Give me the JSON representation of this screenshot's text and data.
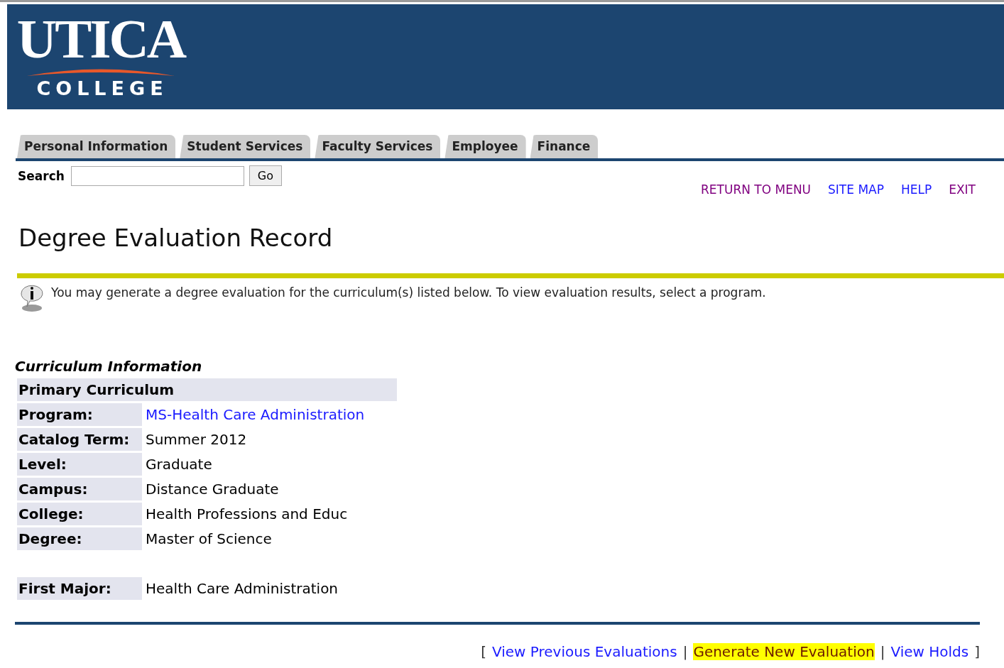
{
  "header": {
    "logo_word": "UTICA",
    "logo_subword": "COLLEGE"
  },
  "tabs": [
    {
      "label": "Personal Information"
    },
    {
      "label": "Student Services"
    },
    {
      "label": "Faculty Services"
    },
    {
      "label": "Employee"
    },
    {
      "label": "Finance"
    }
  ],
  "search": {
    "label": "Search",
    "button": "Go"
  },
  "nav_links": [
    {
      "label": "RETURN TO MENU",
      "visited": true
    },
    {
      "label": "SITE MAP",
      "visited": false
    },
    {
      "label": "HELP",
      "visited": false
    },
    {
      "label": "EXIT",
      "visited": true
    }
  ],
  "title": "Degree Evaluation Record",
  "info_message": "You may generate a degree evaluation for the curriculum(s) listed below. To view evaluation results, select a program.",
  "curriculum": {
    "heading": "Curriculum Information",
    "section": "Primary Curriculum",
    "rows": [
      {
        "label": "Program:",
        "value": "MS-Health Care Administration",
        "kind": "link"
      },
      {
        "label": "Catalog Term:",
        "value": "Summer 2012",
        "kind": "text"
      },
      {
        "label": "Level:",
        "value": "Graduate",
        "kind": "text"
      },
      {
        "label": "Campus:",
        "value": "Distance Graduate",
        "kind": "text"
      },
      {
        "label": "College:",
        "value": "Health Professions and Educ",
        "kind": "text"
      },
      {
        "label": "Degree:",
        "value": "Master of Science",
        "kind": "text"
      }
    ],
    "major_rows": [
      {
        "label": "First Major:",
        "value": "Health Care Administration",
        "kind": "text"
      }
    ]
  },
  "footer_links": [
    {
      "kind": "bracket",
      "text": "["
    },
    {
      "kind": "link",
      "text": "View Previous Evaluations",
      "highlighted": false
    },
    {
      "kind": "separator",
      "text": "|"
    },
    {
      "kind": "link",
      "text": "Generate New Evaluation",
      "highlighted": true
    },
    {
      "kind": "separator",
      "text": "|"
    },
    {
      "kind": "link",
      "text": "View Holds",
      "highlighted": false
    },
    {
      "kind": "bracket",
      "text": "]"
    }
  ]
}
